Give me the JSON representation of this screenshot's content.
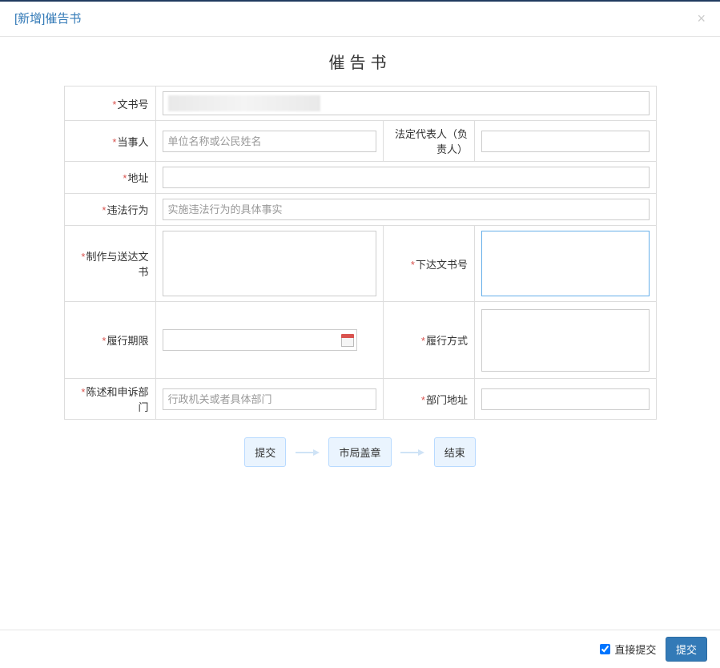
{
  "modal": {
    "title": "[新增]催告书",
    "page_title": "催告书"
  },
  "fields": {
    "doc_no": {
      "label": "文书号",
      "value": ""
    },
    "party": {
      "label": "当事人",
      "placeholder": "单位名称或公民姓名"
    },
    "legal_rep": {
      "label": "法定代表人（负责人）"
    },
    "address": {
      "label": "地址"
    },
    "illegal_act": {
      "label": "违法行为",
      "placeholder": "实施违法行为的具体事实"
    },
    "make_deliver": {
      "label": "制作与送达文书"
    },
    "issued_doc_no": {
      "label": "下达文书号"
    },
    "perform_deadline": {
      "label": "履行期限"
    },
    "perform_method": {
      "label": "履行方式"
    },
    "appeal_dept": {
      "label": "陈述和申诉部门",
      "placeholder": "行政机关或者具体部门"
    },
    "dept_address": {
      "label": "部门地址"
    }
  },
  "workflow": {
    "step1": "提交",
    "step2": "市局盖章",
    "step3": "结束"
  },
  "footer": {
    "direct_submit_label": "直接提交",
    "direct_submit_checked": true,
    "submit_label": "提交"
  }
}
